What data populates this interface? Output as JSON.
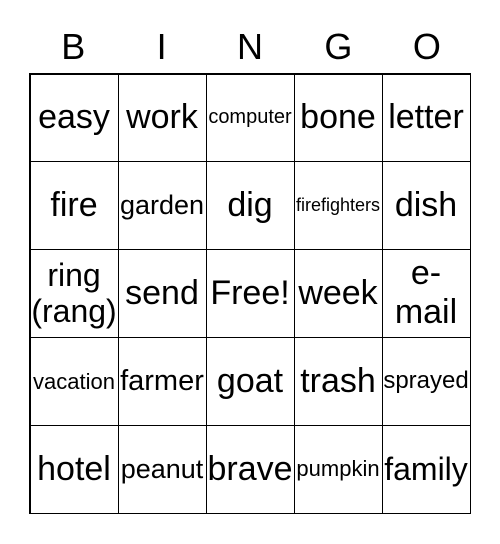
{
  "header": [
    "B",
    "I",
    "N",
    "G",
    "O"
  ],
  "cells": [
    [
      "easy",
      "work",
      "computer",
      "bone",
      "letter"
    ],
    [
      "fire",
      "garden",
      "dig",
      "firefighters",
      "dish"
    ],
    [
      "ring (rang)",
      "send",
      "Free!",
      "week",
      "e-mail"
    ],
    [
      "vacation",
      "farmer",
      "goat",
      "trash",
      "sprayed"
    ],
    [
      "hotel",
      "peanut",
      "brave",
      "pumpkin",
      "family"
    ]
  ]
}
